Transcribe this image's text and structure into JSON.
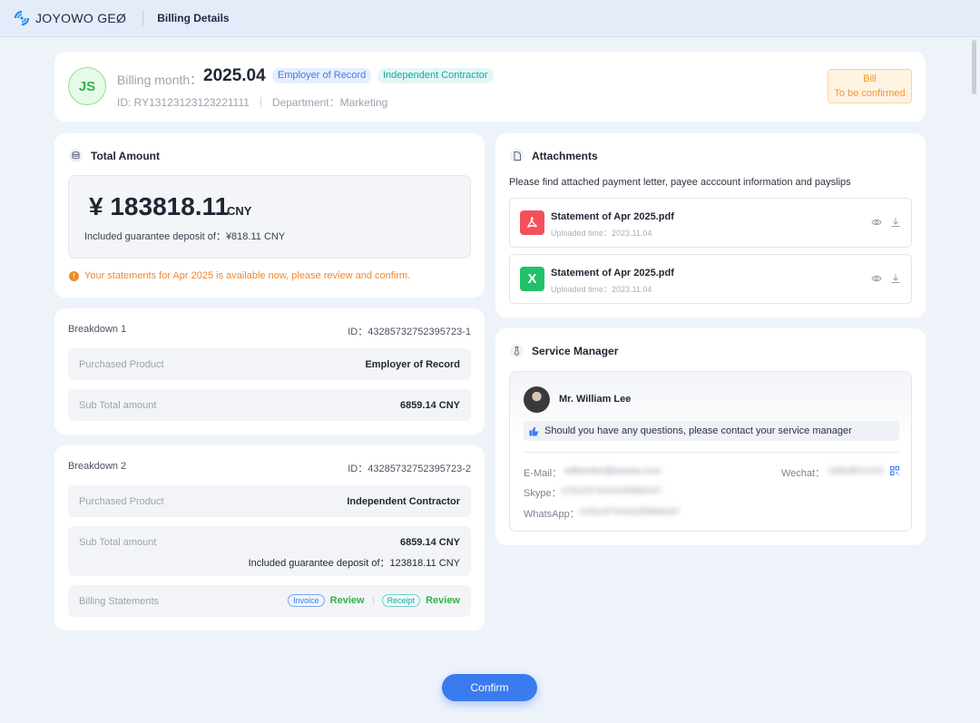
{
  "app": {
    "logo_text": "JOYOWO GEØ",
    "page_name": "Billing Details"
  },
  "header": {
    "avatar_initials": "JS",
    "billing_month_label": "Billing month：",
    "billing_month_value": "2025.04",
    "tag_eor": "Employer of Record",
    "tag_ic": "Independent Contractor",
    "id_text": "ID: RY13123123123221111",
    "department_text": "Department：Marketing",
    "status_line1": "Bill",
    "status_line2": "To be confirmed"
  },
  "total": {
    "title": "Total Amount",
    "amount": "¥ 183818.11",
    "currency": "CNY",
    "deposit": "Included guarantee deposit of：¥818.11 CNY",
    "notice": "Your statements for Apr 2025 is available now, please review and confirm."
  },
  "breakdown1": {
    "title": "Breakdown 1",
    "id": "ID：43285732752395723-1",
    "product_label": "Purchased Product",
    "product_value": "Employer of Record",
    "subtotal_label": "Sub Total amount",
    "subtotal_value": "6859.14 CNY"
  },
  "breakdown2": {
    "title": "Breakdown 2",
    "id": "ID：43285732752395723-2",
    "product_label": "Purchased Product",
    "product_value": "Independent Contractor",
    "subtotal_label": "Sub Total amount",
    "subtotal_value": "6859.14 CNY",
    "deposit_value": "Included guarantee deposit of：123818.11 CNY",
    "statements_label": "Billing Statements",
    "invoice_label": "Invoice",
    "receipt_label": "Receipt",
    "review_label": "Review"
  },
  "attachments": {
    "title": "Attachments",
    "description": "Please find attached payment letter, payee acccount information and payslips",
    "files": [
      {
        "name": "Statement of Apr 2025.pdf",
        "time": "Uploaded time：2023.11.04",
        "icon": "pdf-icon",
        "color": "#f4505a"
      },
      {
        "name": "Statement of Apr 2025.pdf",
        "time": "Uploaded time：2023.11.04",
        "icon": "excel-icon",
        "color": "#21c169"
      }
    ]
  },
  "manager": {
    "title": "Service Manager",
    "name": "Mr. William Lee",
    "tip": "Should you have any questions, please contact your service manager",
    "email_label": "E-Mail：",
    "email_value": "williamlee@joyowo.com",
    "wechat_label": "Wechat：",
    "wechat_value": "13923621213",
    "skype_label": "Skype：",
    "skype_value": "12312371616155566167",
    "whatsapp_label": "WhatsApp：",
    "whatsapp_value": "12312371616155566167"
  },
  "actions": {
    "confirm_label": "Confirm"
  }
}
